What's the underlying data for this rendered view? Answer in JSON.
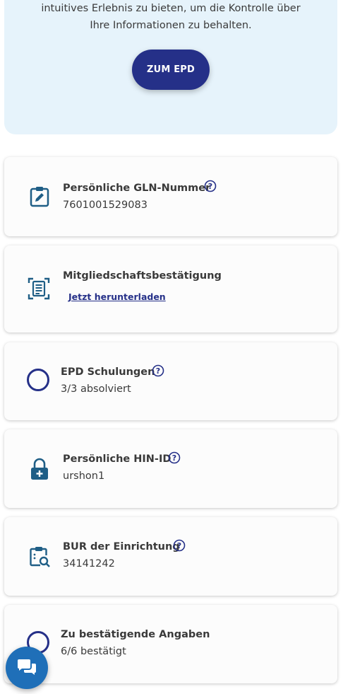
{
  "hero": {
    "text": "intuitives Erlebnis zu bieten, um die Kontrolle über\nIhre Informationen zu behalten.",
    "button_label": "ZUM EPD"
  },
  "cards": {
    "gln": {
      "title": "Persönliche GLN-Nummer",
      "value": "7601001529083",
      "icon": "clipboard-edit-icon"
    },
    "membership": {
      "title": "Mitgliedschaftsbestätigung",
      "link": "Jetzt herunterladen",
      "icon": "document-scan-icon"
    },
    "trainings": {
      "title": "EPD Schulungen",
      "value": "3/3 absolviert",
      "icon": "progress-ring-icon"
    },
    "hin": {
      "title": "Persönliche HIN-ID",
      "value": "urshon1",
      "icon": "lock-plus-icon"
    },
    "bur": {
      "title": "BUR der Einrichtung",
      "value": "34141242",
      "icon": "clipboard-search-icon"
    },
    "confirm": {
      "title": "Zu bestätigende Angaben",
      "value": "6/6 bestätigt",
      "icon": "progress-ring-icon"
    }
  },
  "colors": {
    "primary": "#253088",
    "icon_teal": "#1f5e86",
    "hero_bg": "#e6f3fb",
    "chat_bg": "#1f6fb8"
  },
  "chat": {
    "icon": "chat-bubbles-icon"
  }
}
